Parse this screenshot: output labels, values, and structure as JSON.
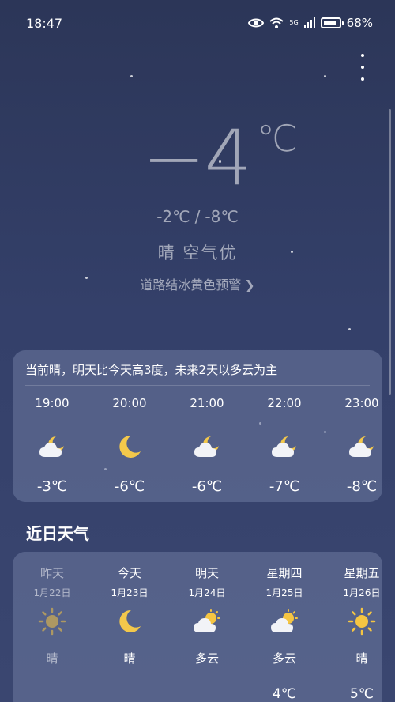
{
  "status": {
    "time": "18:47",
    "battery": "68%",
    "network": "5G"
  },
  "current": {
    "temperature": "−4",
    "unit": "℃",
    "high": "-2℃",
    "separator": "/",
    "low": "-8℃",
    "condition": "晴 空气优",
    "warning": "道路结冰黄色预警",
    "warning_chevron": "❯"
  },
  "hourly": {
    "summary": "当前晴，明天比今天高3度，未来2天以多云为主",
    "items": [
      {
        "time": "19:00",
        "icon": "partly-cloudy-night",
        "temp": "-3℃"
      },
      {
        "time": "20:00",
        "icon": "moon",
        "temp": "-6℃"
      },
      {
        "time": "21:00",
        "icon": "partly-cloudy-night",
        "temp": "-6℃"
      },
      {
        "time": "22:00",
        "icon": "partly-cloudy-night",
        "temp": "-7℃"
      },
      {
        "time": "23:00",
        "icon": "partly-cloudy-night",
        "temp": "-8℃"
      }
    ]
  },
  "daily": {
    "title": "近日天气",
    "items": [
      {
        "name": "昨天",
        "date": "1月22日",
        "icon": "sun",
        "cond": "晴",
        "high": ""
      },
      {
        "name": "今天",
        "date": "1月23日",
        "icon": "moon",
        "cond": "晴",
        "high": ""
      },
      {
        "name": "明天",
        "date": "1月24日",
        "icon": "partly-cloudy",
        "cond": "多云",
        "high": ""
      },
      {
        "name": "星期四",
        "date": "1月25日",
        "icon": "partly-cloudy",
        "cond": "多云",
        "high": "4℃"
      },
      {
        "name": "星期五",
        "date": "1月26日",
        "icon": "sun",
        "cond": "晴",
        "high": "5℃"
      }
    ]
  },
  "colors": {
    "moon": "#f3c84b",
    "sun": "#f5c542",
    "cloud": "#f2f3f7"
  }
}
